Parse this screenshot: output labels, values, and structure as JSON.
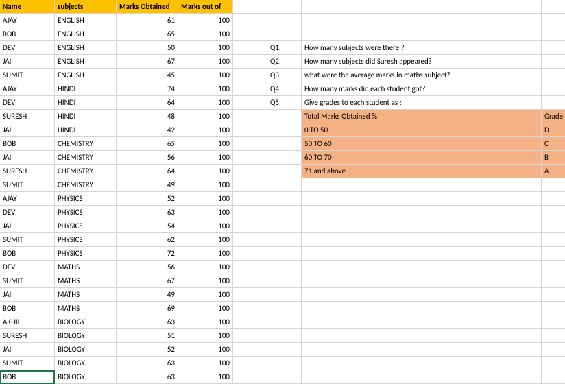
{
  "headers": [
    "Name",
    "subjects",
    "Marks Obtained",
    "Marks out of"
  ],
  "rows": [
    [
      "AJAY",
      "ENGLISH",
      "61",
      "100"
    ],
    [
      "BOB",
      "ENGLISH",
      "65",
      "100"
    ],
    [
      "DEV",
      "ENGLISH",
      "50",
      "100"
    ],
    [
      "JAI",
      "ENGLISH",
      "67",
      "100"
    ],
    [
      "SUMIT",
      "ENGLISH",
      "45",
      "100"
    ],
    [
      "AJAY",
      "HINDI",
      "74",
      "100"
    ],
    [
      "DEV",
      "HINDI",
      "64",
      "100"
    ],
    [
      "SURESH",
      "HINDI",
      "48",
      "100"
    ],
    [
      "JAI",
      "HINDI",
      "42",
      "100"
    ],
    [
      "BOB",
      "CHEMISTRY",
      "65",
      "100"
    ],
    [
      "JAI",
      "CHEMISTRY",
      "56",
      "100"
    ],
    [
      "SURESH",
      "CHEMISTRY",
      "64",
      "100"
    ],
    [
      "SUMIT",
      "CHEMISTRY",
      "49",
      "100"
    ],
    [
      "AJAY",
      "PHYSICS",
      "52",
      "100"
    ],
    [
      "DEV",
      "PHYSICS",
      "63",
      "100"
    ],
    [
      "JAI",
      "PHYSICS",
      "54",
      "100"
    ],
    [
      "SUMIT",
      "PHYSICS",
      "62",
      "100"
    ],
    [
      "BOB",
      "PHYSICS",
      "72",
      "100"
    ],
    [
      "DEV",
      "MATHS",
      "56",
      "100"
    ],
    [
      "SUMIT",
      "MATHS",
      "67",
      "100"
    ],
    [
      "JAI",
      "MATHS",
      "49",
      "100"
    ],
    [
      "BOB",
      "MATHS",
      "69",
      "100"
    ],
    [
      "AKHIL",
      "BIOLOGY",
      "63",
      "100"
    ],
    [
      "SURESH",
      "BIOLOGY",
      "51",
      "100"
    ],
    [
      "JAI",
      "BIOLOGY",
      "52",
      "100"
    ],
    [
      "SUMIT",
      "BIOLOGY",
      "63",
      "100"
    ],
    [
      "BOB",
      "BIOLOGY",
      "63",
      "100"
    ]
  ],
  "questions": [
    {
      "q": "Q1.",
      "text": "How many subjects were there ?"
    },
    {
      "q": "Q2.",
      "text": "How many subjects did Suresh appeared?"
    },
    {
      "q": "Q3.",
      "text": "what were the average marks in maths subject?"
    },
    {
      "q": "Q4.",
      "text": "How many marks did each student got?"
    },
    {
      "q": "Q5.",
      "text": "Give grades to each student as :"
    }
  ],
  "gradeTable": {
    "header": {
      "left": "Total Marks Obtained %",
      "right": "Grade"
    },
    "rows": [
      {
        "left": "0 TO 50",
        "right": "D"
      },
      {
        "left": "50 TO 60",
        "right": "C"
      },
      {
        "left": "60 TO 70",
        "right": "B"
      },
      {
        "left": "71 and above",
        "right": "A"
      }
    ]
  }
}
